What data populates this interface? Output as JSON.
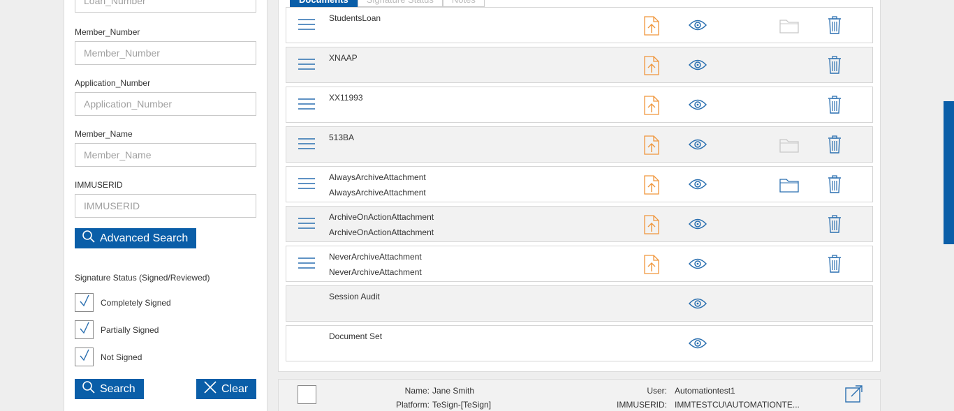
{
  "search": {
    "fields": [
      {
        "label": "",
        "placeholder": "Loan_Number"
      },
      {
        "label": "Member_Number",
        "placeholder": "Member_Number"
      },
      {
        "label": "Application_Number",
        "placeholder": "Application_Number"
      },
      {
        "label": "Member_Name",
        "placeholder": "Member_Name"
      },
      {
        "label": "IMMUSERID",
        "placeholder": "IMMUSERID"
      }
    ],
    "advanced_search_label": "Advanced Search",
    "signature_status_title": "Signature Status (Signed/Reviewed)",
    "checkboxes": [
      {
        "label": "Completely Signed",
        "checked": true
      },
      {
        "label": "Partially Signed",
        "checked": true
      },
      {
        "label": "Not Signed",
        "checked": true
      }
    ],
    "search_label": "Search",
    "clear_label": "Clear"
  },
  "tabs": [
    "Documents",
    "Signature Status",
    "Notes"
  ],
  "documents": [
    {
      "name": "StudentsLoan",
      "subtitle": "",
      "has_menu": true,
      "has_upload": true,
      "has_folder": true,
      "folder_state": "dim",
      "has_trash": true
    },
    {
      "name": "XNAAP",
      "subtitle": "",
      "has_menu": true,
      "has_upload": true,
      "has_folder": false,
      "has_trash": true
    },
    {
      "name": "XX11993",
      "subtitle": "",
      "has_menu": true,
      "has_upload": true,
      "has_folder": false,
      "has_trash": true
    },
    {
      "name": "513BA",
      "subtitle": "",
      "has_menu": true,
      "has_upload": true,
      "has_folder": true,
      "folder_state": "dim",
      "has_trash": true
    },
    {
      "name": "AlwaysArchiveAttachment",
      "subtitle": "AlwaysArchiveAttachment",
      "has_menu": true,
      "has_upload": true,
      "has_folder": true,
      "folder_state": "active",
      "has_trash": true
    },
    {
      "name": "ArchiveOnActionAttachment",
      "subtitle": "ArchiveOnActionAttachment",
      "has_menu": true,
      "has_upload": true,
      "has_folder": false,
      "has_trash": true
    },
    {
      "name": "NeverArchiveAttachment",
      "subtitle": "NeverArchiveAttachment",
      "has_menu": true,
      "has_upload": true,
      "has_folder": false,
      "has_trash": true
    },
    {
      "name": "Session Audit",
      "subtitle": "",
      "has_menu": false,
      "has_upload": false,
      "has_folder": false,
      "has_trash": false
    },
    {
      "name": "Document Set",
      "subtitle": "",
      "has_menu": false,
      "has_upload": false,
      "has_folder": false,
      "has_trash": false
    }
  ],
  "info": {
    "name_label": "Name:",
    "name_value": "Jane Smith",
    "platform_label": "Platform:",
    "platform_value": "TeSign-[TeSign]",
    "user_label": "User:",
    "user_value": "Automationtest1",
    "immuserid_label": "IMMUSERID:",
    "immuserid_value": "IMMTESTCU\\AUTOMATIONTE..."
  },
  "colors": {
    "accent": "#0a5ea8",
    "icon_blue": "#2a6fb0",
    "upload_orange": "#f0963c",
    "folder_dim": "#c8c8c8",
    "row_alt": "#f2f2f2"
  }
}
